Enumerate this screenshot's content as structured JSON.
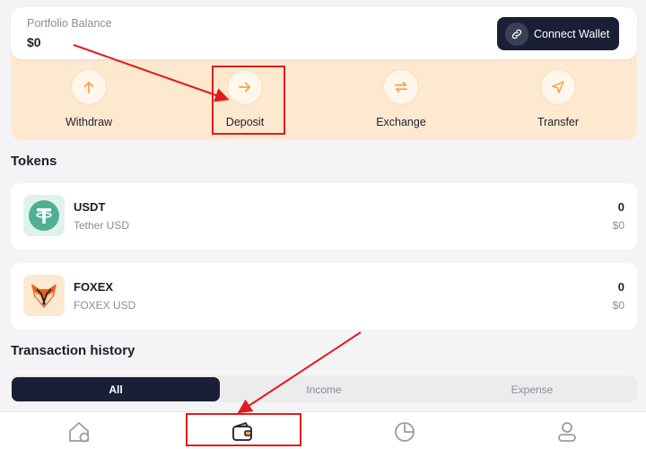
{
  "balance": {
    "label": "Portfolio Balance",
    "value": "$0",
    "connect_label": "Connect Wallet"
  },
  "actions": [
    {
      "label": "Withdraw",
      "icon": "arrow-up-icon"
    },
    {
      "label": "Deposit",
      "icon": "arrow-right-icon"
    },
    {
      "label": "Exchange",
      "icon": "swap-icon"
    },
    {
      "label": "Transfer",
      "icon": "send-icon"
    }
  ],
  "tokens_title": "Tokens",
  "tokens": [
    {
      "symbol": "USDT",
      "name": "Tether USD",
      "amount": "0",
      "usd": "$0",
      "icon": "tether-icon"
    },
    {
      "symbol": "FOXEX",
      "name": "FOXEX USD",
      "amount": "0",
      "usd": "$0",
      "icon": "fox-icon"
    }
  ],
  "history_title": "Transaction history",
  "filters": [
    {
      "label": "All",
      "active": true
    },
    {
      "label": "Income",
      "active": false
    },
    {
      "label": "Expense",
      "active": false
    }
  ],
  "nav": [
    {
      "icon": "home-icon"
    },
    {
      "icon": "wallet-icon",
      "active": true
    },
    {
      "icon": "pie-chart-icon"
    },
    {
      "icon": "user-icon"
    }
  ],
  "colors": {
    "accent_orange": "#f2a24a",
    "dark_navy": "#1a1f36",
    "panel_peach": "#fde8d0",
    "annotation_red": "#e21b1b",
    "tether_green": "#50af95"
  }
}
